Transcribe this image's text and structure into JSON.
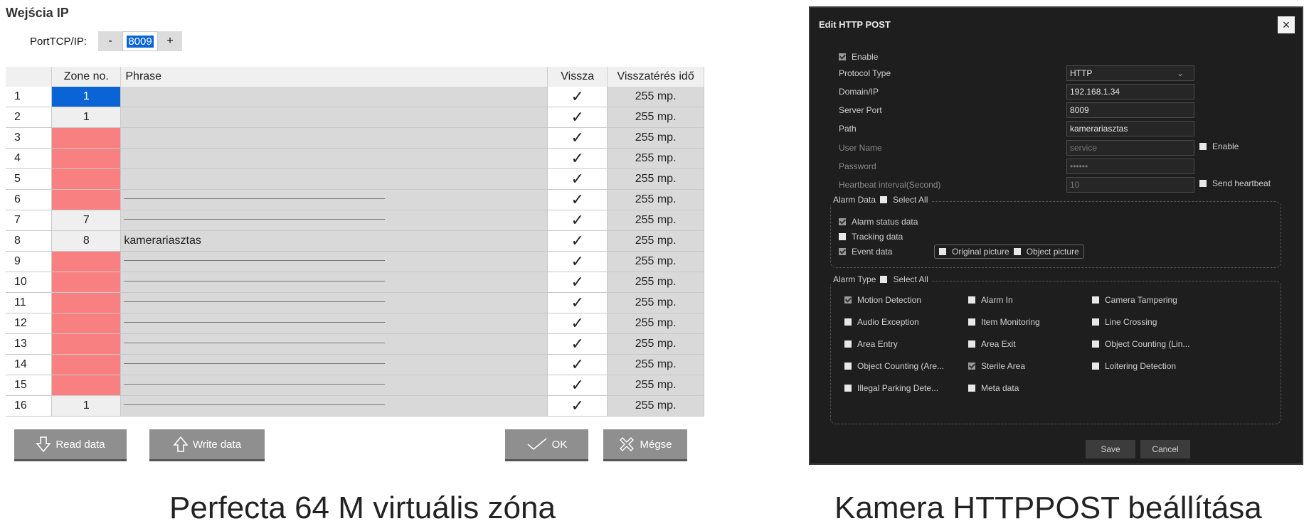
{
  "left": {
    "title": "Wejścia IP",
    "port_label": "PortTCP/IP:",
    "minus": "-",
    "plus": "+",
    "port_value": "8009",
    "headers": [
      "",
      "Zone no.",
      "Phrase",
      "Vissza",
      "Visszatérés idő"
    ],
    "rows": [
      {
        "n": "1",
        "zone": "1",
        "phrase": "",
        "check": "✓",
        "time": "255 mp."
      },
      {
        "n": "2",
        "zone": "1",
        "phrase": "",
        "check": "✓",
        "time": "255 mp."
      },
      {
        "n": "3",
        "zone": "",
        "phrase": "",
        "check": "✓",
        "time": "255 mp."
      },
      {
        "n": "4",
        "zone": "",
        "phrase": "",
        "check": "✓",
        "time": "255 mp."
      },
      {
        "n": "5",
        "zone": "",
        "phrase": "",
        "check": "✓",
        "time": "255 mp."
      },
      {
        "n": "6",
        "zone": "",
        "phrase": "",
        "check": "✓",
        "time": "255 mp."
      },
      {
        "n": "7",
        "zone": "7",
        "phrase": "",
        "check": "✓",
        "time": "255 mp."
      },
      {
        "n": "8",
        "zone": "8",
        "phrase": "kamerariasztas",
        "check": "✓",
        "time": "255 mp."
      },
      {
        "n": "9",
        "zone": "",
        "phrase": "",
        "check": "✓",
        "time": "255 mp."
      },
      {
        "n": "10",
        "zone": "",
        "phrase": "",
        "check": "✓",
        "time": "255 mp."
      },
      {
        "n": "11",
        "zone": "",
        "phrase": "",
        "check": "✓",
        "time": "255 mp."
      },
      {
        "n": "12",
        "zone": "",
        "phrase": "",
        "check": "✓",
        "time": "255 mp."
      },
      {
        "n": "13",
        "zone": "",
        "phrase": "",
        "check": "✓",
        "time": "255 mp."
      },
      {
        "n": "14",
        "zone": "",
        "phrase": "",
        "check": "✓",
        "time": "255 mp."
      },
      {
        "n": "15",
        "zone": "",
        "phrase": "",
        "check": "✓",
        "time": "255 mp."
      },
      {
        "n": "16",
        "zone": "1",
        "phrase": "",
        "check": "✓",
        "time": "255 mp."
      }
    ],
    "buttons": {
      "read": "Read data",
      "write": "Write data",
      "ok": "OK",
      "cancel": "Mégse"
    },
    "caption": "Perfecta 64 M virtuális zóna"
  },
  "right": {
    "title": "Edit HTTP POST",
    "close": "×",
    "enable": "Enable",
    "fields": [
      {
        "label": "Protocol Type",
        "value": "HTTP"
      },
      {
        "label": "Domain/IP",
        "value": "192.168.1.34"
      },
      {
        "label": "Server Port",
        "value": "8009"
      },
      {
        "label": "Path",
        "value": "kamerariasztas"
      },
      {
        "label": "User Name",
        "value": "service"
      },
      {
        "label": "Password",
        "value": "••••••"
      },
      {
        "label": "Heartbeat interval(Second)",
        "value": "10"
      }
    ],
    "user_enable": "Enable",
    "send_heartbeat": "Send heartbeat",
    "alarm_data_label": "Alarm Data",
    "select_all": "Select All",
    "alarm_status": "Alarm status data",
    "tracking": "Tracking data",
    "event": "Event data",
    "original_picture": "Original picture",
    "object_picture": "Object picture",
    "alarm_type_label": "Alarm Type",
    "types": [
      "Motion Detection",
      "Alarm In",
      "Camera Tampering",
      "Audio Exception",
      "Item Monitoring",
      "Line Crossing",
      "Area Entry",
      "Area Exit",
      "Object Counting (Lin...",
      "Object Counting (Are...",
      "Sterile Area",
      "Loitering Detection",
      "Illegal Parking Dete...",
      "Meta data"
    ],
    "save": "Save",
    "cancel": "Cancel",
    "caption": "Kamera HTTPPOST beállítása"
  }
}
